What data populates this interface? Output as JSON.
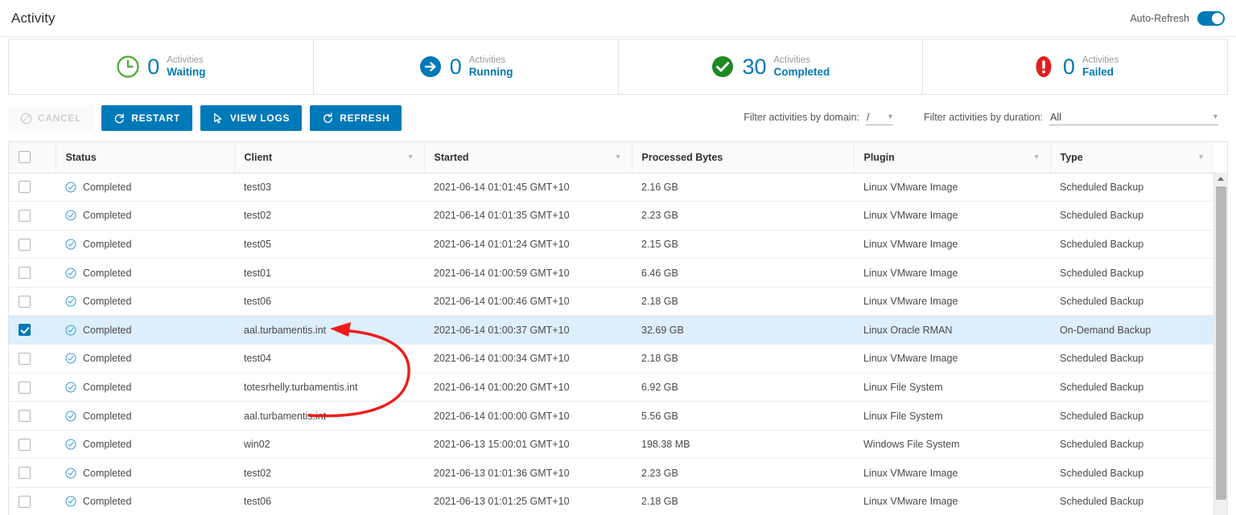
{
  "header": {
    "title": "Activity",
    "auto_refresh_label": "Auto-Refresh",
    "auto_refresh_on": true
  },
  "summary_cards": [
    {
      "icon": "clock-icon",
      "count": "0",
      "line1": "Activities",
      "line2": "Waiting",
      "color": "#4aa832"
    },
    {
      "icon": "arrow-right-circle-icon",
      "count": "0",
      "line1": "Activities",
      "line2": "Running",
      "color": "#0079b8"
    },
    {
      "icon": "check-circle-icon",
      "count": "30",
      "line1": "Activities",
      "line2": "Completed",
      "color": "#1c8a23"
    },
    {
      "icon": "error-circle-icon",
      "count": "0",
      "line1": "Activities",
      "line2": "Failed",
      "color": "#e02020"
    }
  ],
  "toolbar": {
    "buttons": [
      {
        "label": "CANCEL",
        "icon": "cancel-icon",
        "disabled": true
      },
      {
        "label": "RESTART",
        "icon": "restart-icon",
        "disabled": false
      },
      {
        "label": "VIEW LOGS",
        "icon": "logs-icon",
        "disabled": false
      },
      {
        "label": "REFRESH",
        "icon": "refresh-icon",
        "disabled": false
      }
    ],
    "filter_domain": {
      "label": "Filter activities by domain:",
      "value": "/"
    },
    "filter_duration": {
      "label": "Filter activities by duration:",
      "value": "All"
    }
  },
  "table": {
    "columns": [
      {
        "label": "Status",
        "sortable": false
      },
      {
        "label": "Client",
        "sortable": true
      },
      {
        "label": "Started",
        "sortable": true
      },
      {
        "label": "Processed Bytes",
        "sortable": false
      },
      {
        "label": "Plugin",
        "sortable": true
      },
      {
        "label": "Type",
        "sortable": true
      }
    ],
    "header_checkbox_checked": false,
    "rows": [
      {
        "checked": false,
        "status": "Completed",
        "client": "test03",
        "started": "2021-06-14 01:01:45 GMT+10",
        "bytes": "2.16 GB",
        "plugin": "Linux VMware Image",
        "type": "Scheduled Backup"
      },
      {
        "checked": false,
        "status": "Completed",
        "client": "test02",
        "started": "2021-06-14 01:01:35 GMT+10",
        "bytes": "2.23 GB",
        "plugin": "Linux VMware Image",
        "type": "Scheduled Backup"
      },
      {
        "checked": false,
        "status": "Completed",
        "client": "test05",
        "started": "2021-06-14 01:01:24 GMT+10",
        "bytes": "2.15 GB",
        "plugin": "Linux VMware Image",
        "type": "Scheduled Backup"
      },
      {
        "checked": false,
        "status": "Completed",
        "client": "test01",
        "started": "2021-06-14 01:00:59 GMT+10",
        "bytes": "6.46 GB",
        "plugin": "Linux VMware Image",
        "type": "Scheduled Backup"
      },
      {
        "checked": false,
        "status": "Completed",
        "client": "test06",
        "started": "2021-06-14 01:00:46 GMT+10",
        "bytes": "2.18 GB",
        "plugin": "Linux VMware Image",
        "type": "Scheduled Backup"
      },
      {
        "checked": true,
        "status": "Completed",
        "client": "aal.turbamentis.int",
        "started": "2021-06-14 01:00:37 GMT+10",
        "bytes": "32.69 GB",
        "plugin": "Linux Oracle RMAN",
        "type": "On-Demand Backup"
      },
      {
        "checked": false,
        "status": "Completed",
        "client": "test04",
        "started": "2021-06-14 01:00:34 GMT+10",
        "bytes": "2.18 GB",
        "plugin": "Linux VMware Image",
        "type": "Scheduled Backup"
      },
      {
        "checked": false,
        "status": "Completed",
        "client": "totesrhelly.turbamentis.int",
        "started": "2021-06-14 01:00:20 GMT+10",
        "bytes": "6.92 GB",
        "plugin": "Linux File System",
        "type": "Scheduled Backup"
      },
      {
        "checked": false,
        "status": "Completed",
        "client": "aal.turbamentis.int",
        "started": "2021-06-14 01:00:00 GMT+10",
        "bytes": "5.56 GB",
        "plugin": "Linux File System",
        "type": "Scheduled Backup"
      },
      {
        "checked": false,
        "status": "Completed",
        "client": "win02",
        "started": "2021-06-13 15:00:01 GMT+10",
        "bytes": "198.38 MB",
        "plugin": "Windows File System",
        "type": "Scheduled Backup"
      },
      {
        "checked": false,
        "status": "Completed",
        "client": "test02",
        "started": "2021-06-13 01:01:36 GMT+10",
        "bytes": "2.23 GB",
        "plugin": "Linux VMware Image",
        "type": "Scheduled Backup"
      },
      {
        "checked": false,
        "status": "Completed",
        "client": "test06",
        "started": "2021-06-13 01:01:25 GMT+10",
        "bytes": "2.18 GB",
        "plugin": "Linux VMware Image",
        "type": "Scheduled Backup"
      }
    ]
  },
  "annotation": {
    "type": "curved-arrow",
    "color": "#ee1c1c",
    "points_from_row": 8,
    "points_to_row": 5
  }
}
